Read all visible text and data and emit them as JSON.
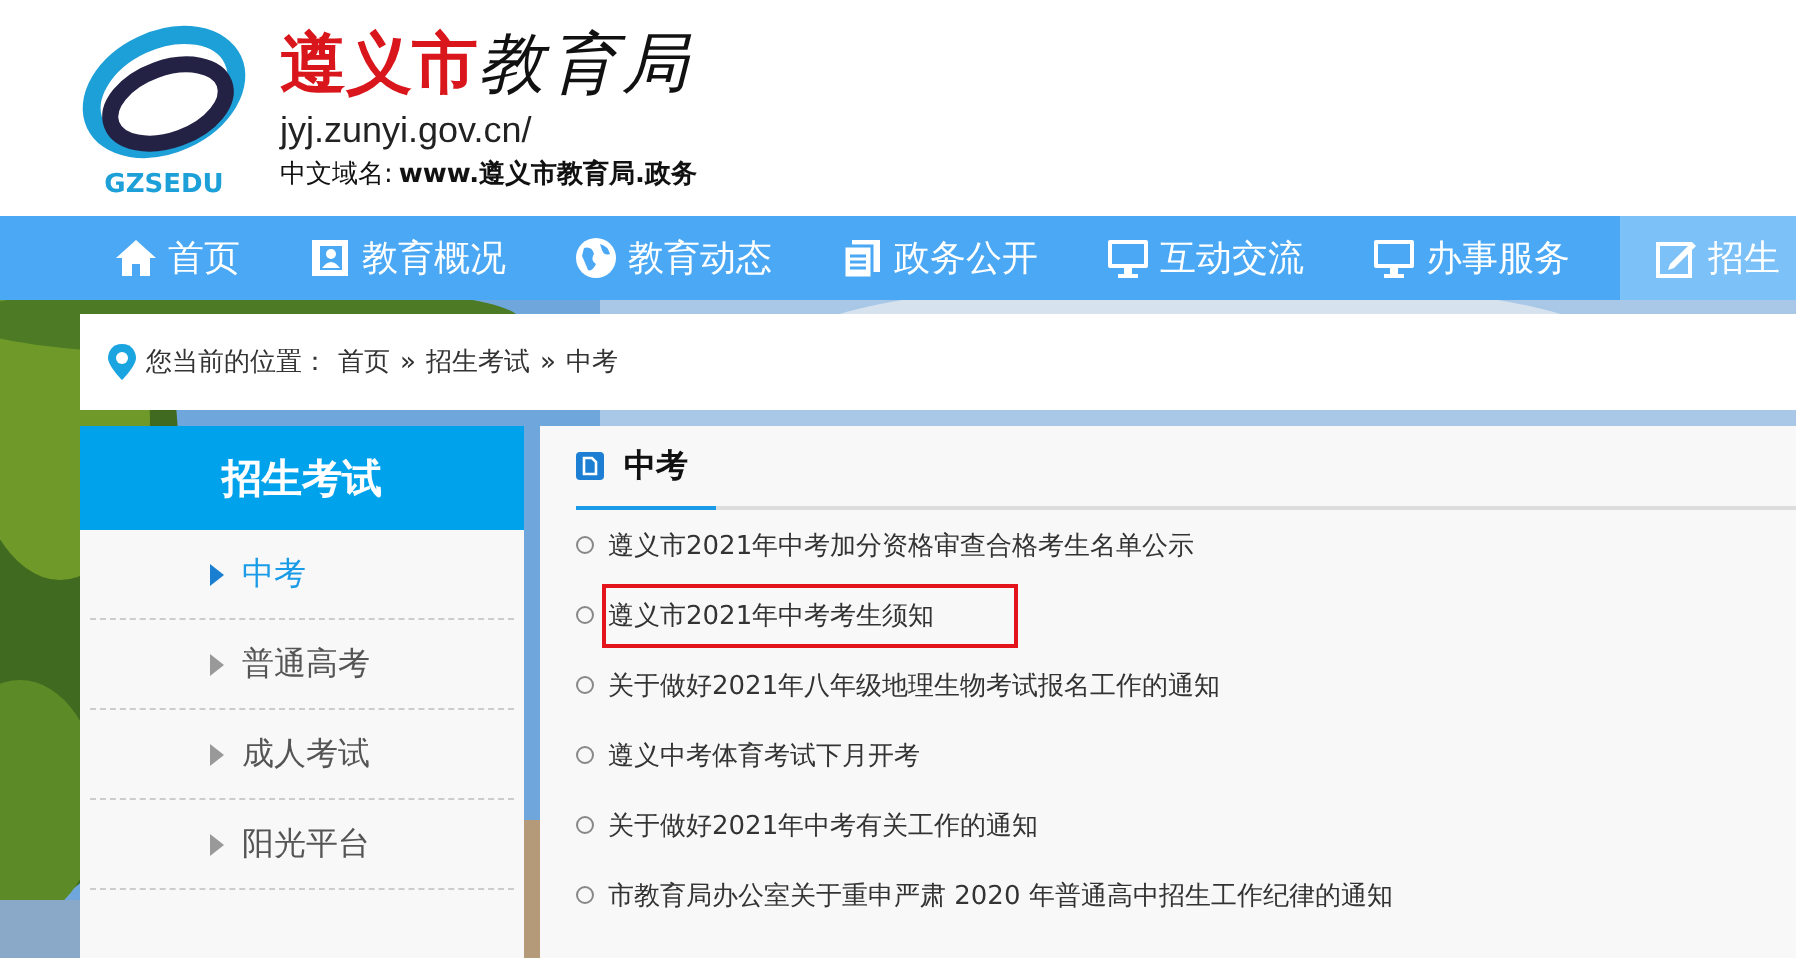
{
  "header": {
    "logo_text": "GZSEDU",
    "title_red": "遵义市",
    "title_black": "教育局",
    "domain": "jyj.zunyi.gov.cn/",
    "cn_domain_label": "中文域名:",
    "cn_domain": "www.遵义市教育局.政务"
  },
  "nav": [
    {
      "label": "首页",
      "kind": "home",
      "selected": false
    },
    {
      "label": "教育概况",
      "kind": "contact",
      "selected": false
    },
    {
      "label": "教育动态",
      "kind": "globe",
      "selected": false
    },
    {
      "label": "政务公开",
      "kind": "docs",
      "selected": false
    },
    {
      "label": "互动交流",
      "kind": "monitor",
      "selected": false
    },
    {
      "label": "办事服务",
      "kind": "monitor",
      "selected": false
    },
    {
      "label": "招生",
      "kind": "edit",
      "selected": true
    }
  ],
  "breadcrumb": {
    "label": "您当前的位置：",
    "items": [
      "首页",
      "招生考试",
      "中考"
    ],
    "separator": "»"
  },
  "sidebar": {
    "title": "招生考试",
    "items": [
      {
        "label": "中考",
        "selected": true
      },
      {
        "label": "普通高考",
        "selected": false
      },
      {
        "label": "成人考试",
        "selected": false
      },
      {
        "label": "阳光平台",
        "selected": false
      }
    ]
  },
  "content": {
    "title": "中考",
    "items": [
      {
        "text": "遵义市2021年中考加分资格审查合格考生名单公示",
        "highlighted": false
      },
      {
        "text": "遵义市2021年中考考生须知",
        "highlighted": true
      },
      {
        "text": "关于做好2021年八年级地理生物考试报名工作的通知",
        "highlighted": false
      },
      {
        "text": "遵义中考体育考试下月开考",
        "highlighted": false
      },
      {
        "text": "关于做好2021年中考有关工作的通知",
        "highlighted": false
      },
      {
        "text": "市教育局办公室关于重申严肃 2020 年普通高中招生工作纪律的通知",
        "highlighted": false
      }
    ]
  }
}
